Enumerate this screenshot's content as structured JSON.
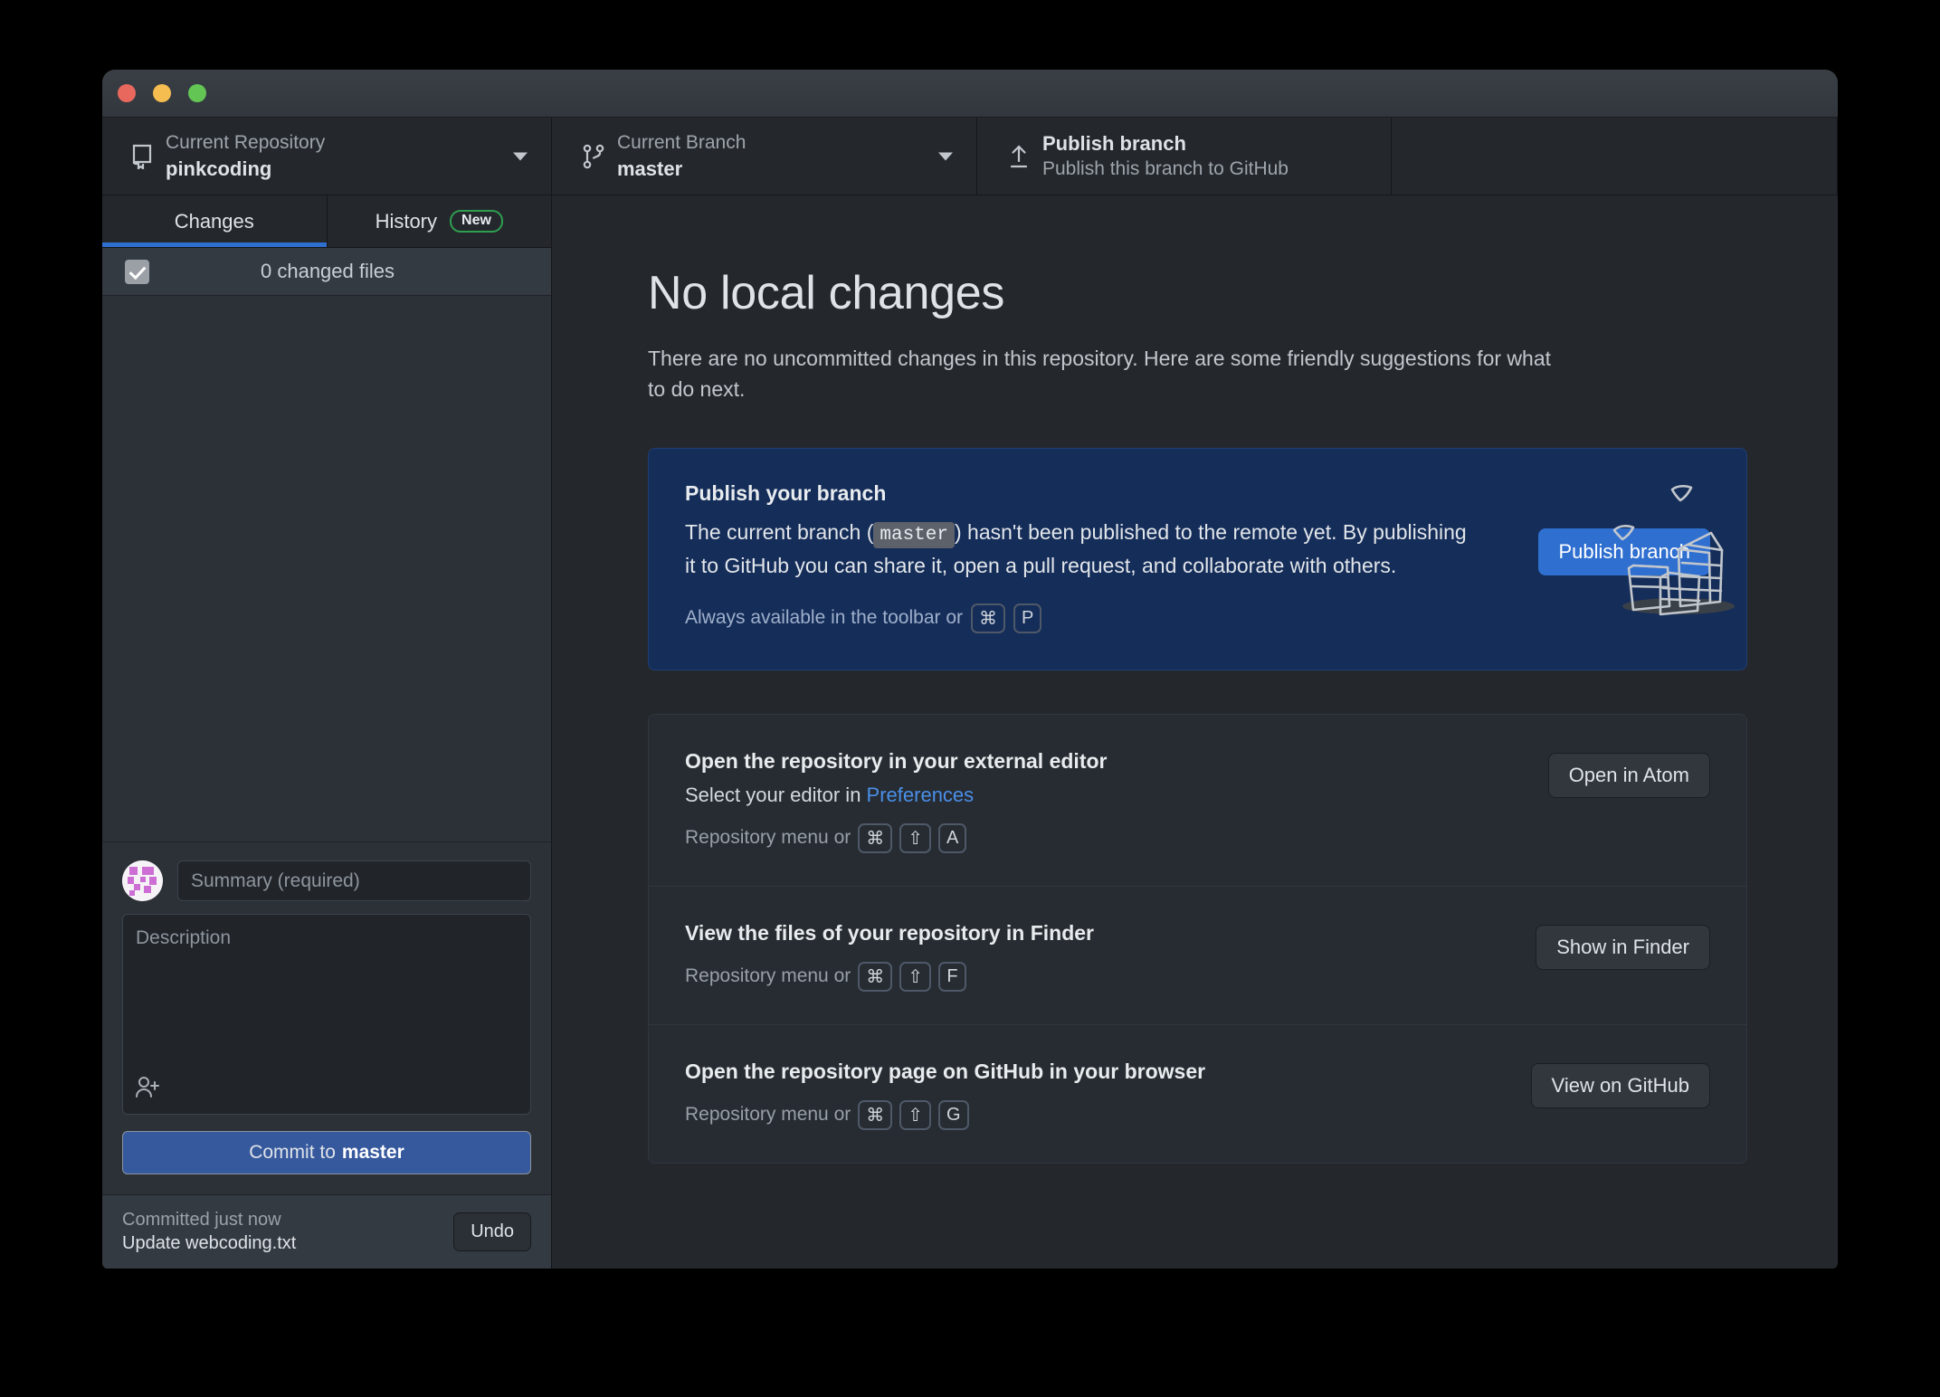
{
  "window": {
    "traffic_lights": [
      {
        "name": "close",
        "color": "#e9685e"
      },
      {
        "name": "minimize",
        "color": "#f5bd4f"
      },
      {
        "name": "zoom",
        "color": "#62c554"
      }
    ]
  },
  "toolbar": {
    "repository": {
      "icon": "repository-icon",
      "label": "Current Repository",
      "value": "pinkcoding"
    },
    "branch": {
      "icon": "branch-icon",
      "label": "Current Branch",
      "value": "master"
    },
    "publish": {
      "icon": "upload-icon",
      "title": "Publish branch",
      "subtitle": "Publish this branch to GitHub"
    }
  },
  "sidebar": {
    "tabs": [
      {
        "label": "Changes",
        "active": true,
        "badge": null
      },
      {
        "label": "History",
        "active": false,
        "badge": "New"
      }
    ],
    "files_header": {
      "count_text": "0 changed files",
      "checked": true
    },
    "commit_form": {
      "summary_placeholder": "Summary (required)",
      "summary_value": "",
      "description_placeholder": "Description",
      "description_value": "",
      "coauthor_icon": "add-coauthor-icon",
      "commit_button_prefix": "Commit to ",
      "commit_button_branch": "master"
    },
    "undo_bar": {
      "status": "Committed just now",
      "commit_message": "Update webcoding.txt",
      "undo_label": "Undo"
    }
  },
  "main": {
    "title": "No local changes",
    "subtitle": "There are no uncommitted changes in this repository. Here are some friendly suggestions for what to do next.",
    "illustration": "paper-stack-illustration",
    "publish_card": {
      "heading": "Publish your branch",
      "body_part1": "The current branch (",
      "branch_chip": "master",
      "body_part2": ") hasn't been published to the remote yet. By publishing it to GitHub you can share it, open a pull request, and collaborate with others.",
      "footer_text": "Always available in the toolbar or",
      "keys": [
        "⌘",
        "P"
      ],
      "button_label": "Publish branch",
      "accent_color": "#2f6fd0",
      "background_color": "#152d59"
    },
    "suggestions": [
      {
        "heading": "Open the repository in your external editor",
        "sub_prefix": "Select your editor in ",
        "sub_link": "Preferences",
        "footer_text": "Repository menu or",
        "keys": [
          "⌘",
          "⇧",
          "A"
        ],
        "button_label": "Open in Atom"
      },
      {
        "heading": "View the files of your repository in Finder",
        "sub_prefix": "",
        "sub_link": "",
        "footer_text": "Repository menu or",
        "keys": [
          "⌘",
          "⇧",
          "F"
        ],
        "button_label": "Show in Finder"
      },
      {
        "heading": "Open the repository page on GitHub in your browser",
        "sub_prefix": "",
        "sub_link": "",
        "footer_text": "Repository menu or",
        "keys": [
          "⌘",
          "⇧",
          "G"
        ],
        "button_label": "View on GitHub"
      }
    ]
  }
}
